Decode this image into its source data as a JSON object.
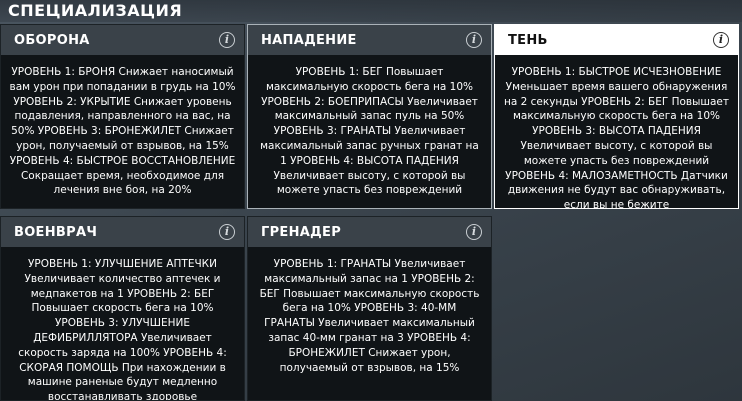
{
  "header": {
    "title": "СПЕЦИАЛИЗАЦИЯ"
  },
  "specializations": [
    {
      "title": "ОБОРОНА",
      "description": "УРОВЕНЬ 1: БРОНЯ Снижает наносимый вам урон при попадании в грудь на 10% УРОВЕНЬ 2: УКРЫТИЕ Снижает уровень подавления, направленного на вас, на 50% УРОВЕНЬ 3: БРОНЕЖИЛЕТ Снижает урон, получаемый от взрывов, на 15% УРОВЕНЬ 4: БЫСТРОЕ ВОССТАНОВЛЕНИЕ Сокращает время, необходимое для лечения вне боя, на 20%"
    },
    {
      "title": "НАПАДЕНИЕ",
      "description": "УРОВЕНЬ 1: БЕГ Повышает максимальную скорость бега на 10% УРОВЕНЬ 2: БОЕПРИПАСЫ Увеличивает максимальный запас пуль на 50% УРОВЕНЬ 3: ГРАНАТЫ Увеличивает максимальный запас ручных гранат на 1 УРОВЕНЬ 4: ВЫСОТА ПАДЕНИЯ Увеличивает высоту, с которой вы можете упасть без повреждений"
    },
    {
      "title": "ТЕНЬ",
      "description": "УРОВЕНЬ 1: БЫСТРОЕ ИСЧЕЗНОВЕНИЕ Уменьшает время вашего обнаружения на 2 секунды УРОВЕНЬ 2: БЕГ Повышает максимальную скорость бега на 10% УРОВЕНЬ 3: ВЫСОТА ПАДЕНИЯ Увеличивает высоту, с которой вы можете упасть без повреждений УРОВЕНЬ 4: МАЛОЗАМЕТНОСТЬ Датчики движения не будут вас обнаруживать, если вы не бежите"
    },
    {
      "title": "ВОЕНВРАЧ",
      "description": "УРОВЕНЬ 1: УЛУЧШЕНИЕ АПТЕЧКИ Увеличивает количество аптечек и медпакетов на 1 УРОВЕНЬ 2: БЕГ Повышает скорость бега на 10% УРОВЕНЬ 3: УЛУЧШЕНИЕ ДЕФИБРИЛЛЯТОРА Увеличивает скорость заряда на 100% УРОВЕНЬ 4: СКОРАЯ ПОМОЩЬ При нахождении в машине раненые будут медленно восстанавливать здоровье"
    },
    {
      "title": "ГРЕНАДЕР",
      "description": "УРОВЕНЬ 1: ГРАНАТЫ Увеличивает максимальный запас на 1 УРОВЕНЬ 2: БЕГ Повышает максимальную скорость бега на 10% УРОВЕНЬ 3: 40-ММ ГРАНАТЫ Увеличивает максимальный запас 40-мм гранат на 3 УРОВЕНЬ 4: БРОНЕЖИЛЕТ Снижает урон, получаемый от взрывов, на 15%"
    }
  ],
  "info_icon_glyph": "i",
  "colors": {
    "card_background": "#101417",
    "card_header": "#3a4249",
    "selected_header": "#ffffff",
    "text": "#ffffff"
  }
}
